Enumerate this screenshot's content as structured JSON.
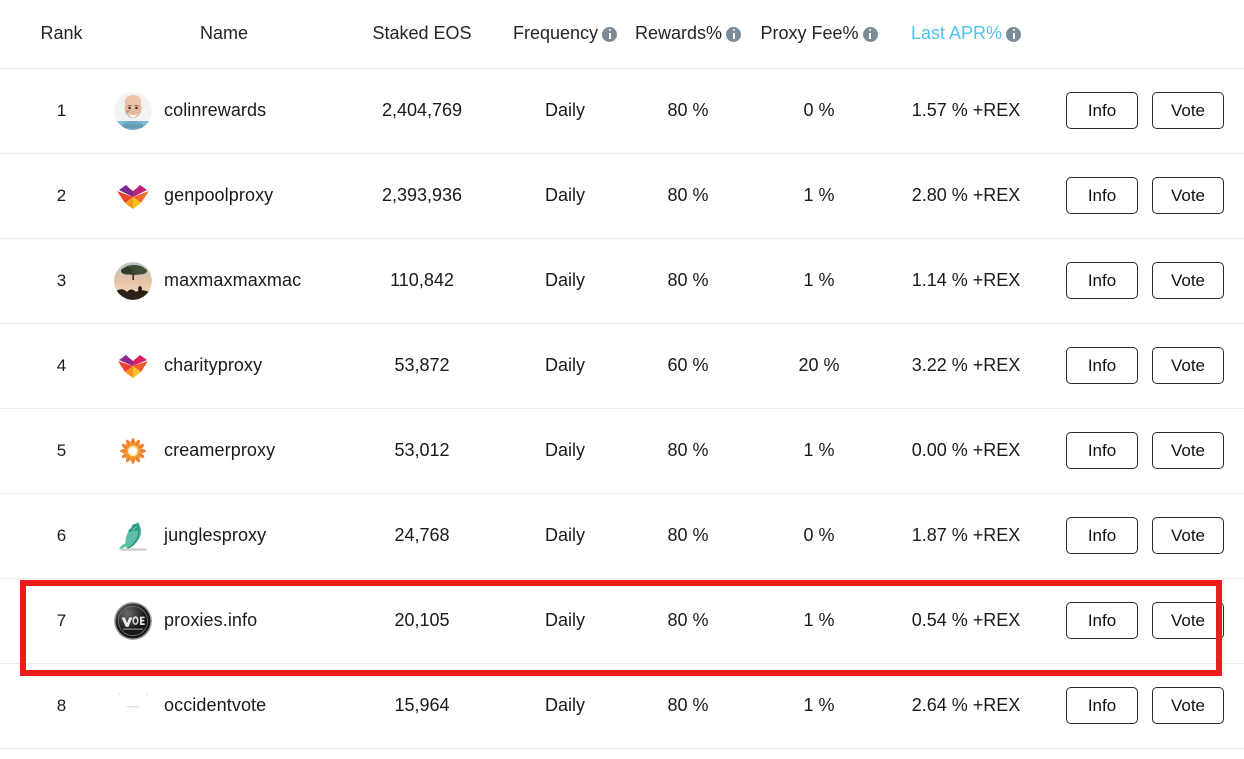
{
  "table": {
    "columns": [
      {
        "key": "rank",
        "label": "Rank",
        "info": false
      },
      {
        "key": "name",
        "label": "Name",
        "info": false
      },
      {
        "key": "stake",
        "label": "Staked EOS",
        "info": false
      },
      {
        "key": "freq",
        "label": "Frequency",
        "info": true
      },
      {
        "key": "rew",
        "label": "Rewards%",
        "info": true
      },
      {
        "key": "fee",
        "label": "Proxy Fee%",
        "info": true
      },
      {
        "key": "apr",
        "label": "Last APR%",
        "info": true
      },
      {
        "key": "act",
        "label": "",
        "info": false
      }
    ],
    "rows": [
      {
        "rank": "1",
        "name": "colinrewards",
        "avatar": "photo-bald-man-avatar",
        "staked_eos": "2,404,769",
        "frequency": "Daily",
        "rewards_pct": "80 %",
        "proxy_fee_pct": "0 %",
        "last_apr": "1.57 % +REX",
        "info_label": "Info",
        "vote_label": "Vote",
        "highlighted": false
      },
      {
        "rank": "2",
        "name": "genpoolproxy",
        "avatar": "geometric-heart-logo",
        "staked_eos": "2,393,936",
        "frequency": "Daily",
        "rewards_pct": "80 %",
        "proxy_fee_pct": "1 %",
        "last_apr": "2.80 % +REX",
        "info_label": "Info",
        "vote_label": "Vote",
        "highlighted": false
      },
      {
        "rank": "3",
        "name": "maxmaxmaxmac",
        "avatar": "photo-sunset-tree-avatar",
        "staked_eos": "110,842",
        "frequency": "Daily",
        "rewards_pct": "80 %",
        "proxy_fee_pct": "1 %",
        "last_apr": "1.14 % +REX",
        "info_label": "Info",
        "vote_label": "Vote",
        "highlighted": false
      },
      {
        "rank": "4",
        "name": "charityproxy",
        "avatar": "pink-heart-logo",
        "staked_eos": "53,872",
        "frequency": "Daily",
        "rewards_pct": "60 %",
        "proxy_fee_pct": "20 %",
        "last_apr": "3.22 % +REX",
        "info_label": "Info",
        "vote_label": "Vote",
        "highlighted": false
      },
      {
        "rank": "5",
        "name": "creamerproxy",
        "avatar": "orange-mandala-logo",
        "staked_eos": "53,012",
        "frequency": "Daily",
        "rewards_pct": "80 %",
        "proxy_fee_pct": "1 %",
        "last_apr": "0.00 % +REX",
        "info_label": "Info",
        "vote_label": "Vote",
        "highlighted": false
      },
      {
        "rank": "6",
        "name": "junglesproxy",
        "avatar": "green-jungle-leaf-logo",
        "staked_eos": "24,768",
        "frequency": "Daily",
        "rewards_pct": "80 %",
        "proxy_fee_pct": "0 %",
        "last_apr": "1.87 % +REX",
        "info_label": "Info",
        "vote_label": "Vote",
        "highlighted": false
      },
      {
        "rank": "7",
        "name": "proxies.info",
        "avatar": "dark-vote-badge-logo",
        "staked_eos": "20,105",
        "frequency": "Daily",
        "rewards_pct": "80 %",
        "proxy_fee_pct": "1 %",
        "last_apr": "0.54 % +REX",
        "info_label": "Info",
        "vote_label": "Vote",
        "highlighted": true
      },
      {
        "rank": "8",
        "name": "occidentvote",
        "avatar": "blank-white-avatar",
        "staked_eos": "15,964",
        "frequency": "Daily",
        "rewards_pct": "80 %",
        "proxy_fee_pct": "1 %",
        "last_apr": "2.64 % +REX",
        "info_label": "Info",
        "vote_label": "Vote",
        "highlighted": false
      }
    ]
  },
  "colors": {
    "apr_header": "#4ec3ea",
    "info_icon": "#7b8a97",
    "highlight_border": "#ee1c1c",
    "row_divider": "#ececec",
    "text": "#1a1a1a"
  },
  "icons": {
    "info": "info-circle-icon"
  }
}
